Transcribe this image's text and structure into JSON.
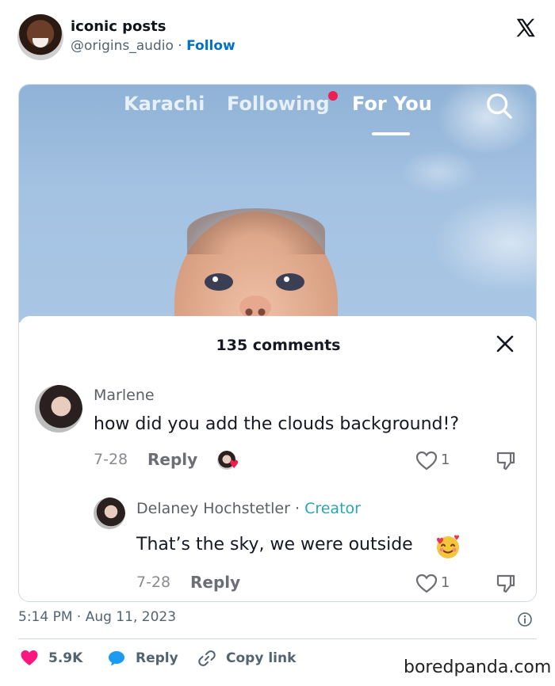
{
  "tweet": {
    "display_name": "iconic posts",
    "handle": "@origins_audio",
    "separator": "·",
    "follow_label": "Follow",
    "timestamp": "5:14 PM · Aug 11, 2023",
    "likes": "5.9K",
    "reply_label": "Reply",
    "copy_link_label": "Copy link"
  },
  "tiktok": {
    "tabs": [
      "Karachi",
      "Following",
      "For You"
    ],
    "active_tab": "For You",
    "comments_header": "135 comments",
    "comments": [
      {
        "author": "Marlene",
        "text": "how did you add the clouds background!?",
        "date": "7-28",
        "reply_label": "Reply",
        "likes": "1",
        "liked_by_creator": true
      },
      {
        "author": "Delaney Hochstetler",
        "badge_separator": "·",
        "badge": "Creator",
        "text": "That’s the sky, we were outside",
        "emoji": "smiling-face-with-hearts",
        "date": "7-28",
        "reply_label": "Reply",
        "likes": "1"
      }
    ]
  },
  "watermark": "boredpanda.com",
  "colors": {
    "follow_blue": "#0070c9",
    "like_pink": "#f91880",
    "reply_blue": "#1d9bf0",
    "tiktok_red": "#ee1d52",
    "creator_teal": "#2aa5b5"
  }
}
